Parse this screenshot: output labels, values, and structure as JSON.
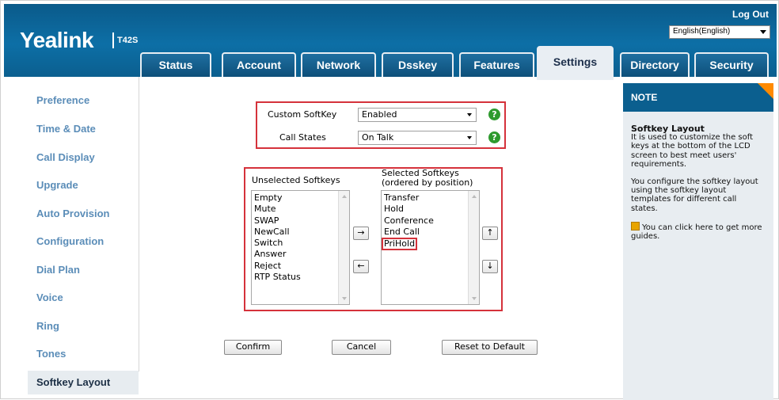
{
  "header": {
    "brand": "Yealink",
    "model": "T42S",
    "logout": "Log Out",
    "language": "English(English)"
  },
  "tabs": [
    {
      "label": "Status"
    },
    {
      "label": "Account"
    },
    {
      "label": "Network"
    },
    {
      "label": "Dsskey"
    },
    {
      "label": "Features"
    },
    {
      "label": "Settings"
    },
    {
      "label": "Directory"
    },
    {
      "label": "Security"
    }
  ],
  "active_tab": "Settings",
  "sidebar": {
    "items": [
      {
        "label": "Preference"
      },
      {
        "label": "Time & Date"
      },
      {
        "label": "Call Display"
      },
      {
        "label": "Upgrade"
      },
      {
        "label": "Auto Provision"
      },
      {
        "label": "Configuration"
      },
      {
        "label": "Dial Plan"
      },
      {
        "label": "Voice"
      },
      {
        "label": "Ring"
      },
      {
        "label": "Tones"
      },
      {
        "label": "Softkey Layout"
      }
    ],
    "active": "Softkey Layout"
  },
  "form": {
    "custom_softkey_label": "Custom SoftKey",
    "custom_softkey_value": "Enabled",
    "call_states_label": "Call States",
    "call_states_value": "On Talk",
    "help_glyph": "?",
    "unselected_label": "Unselected Softkeys",
    "selected_label_line1": "Selected Softkeys",
    "selected_label_line2": "(ordered by position)",
    "unselected": [
      "Empty",
      "Mute",
      "SWAP",
      "NewCall",
      "Switch",
      "Answer",
      "Reject",
      "RTP Status"
    ],
    "selected": [
      "Transfer",
      "Hold",
      "Conference",
      "End Call",
      "PriHold"
    ],
    "highlighted_selected": "PriHold",
    "move_right": "→",
    "move_left": "←",
    "move_up": "↑",
    "move_down": "↓"
  },
  "buttons": {
    "confirm": "Confirm",
    "cancel": "Cancel",
    "reset": "Reset to Default"
  },
  "note": {
    "heading": "NOTE",
    "title": "Softkey Layout",
    "para1": "It is used to customize the soft keys at the bottom of the LCD screen to best meet users' requirements.",
    "para2": "You configure the softkey layout using the softkey layout templates for different call states.",
    "guide": "You can click here to get more guides."
  },
  "colors": {
    "header_blue": "#0d6fa6",
    "highlight_red": "#d5323b",
    "sidebar_link": "#5b8db8",
    "note_orange": "#ff8a00"
  }
}
